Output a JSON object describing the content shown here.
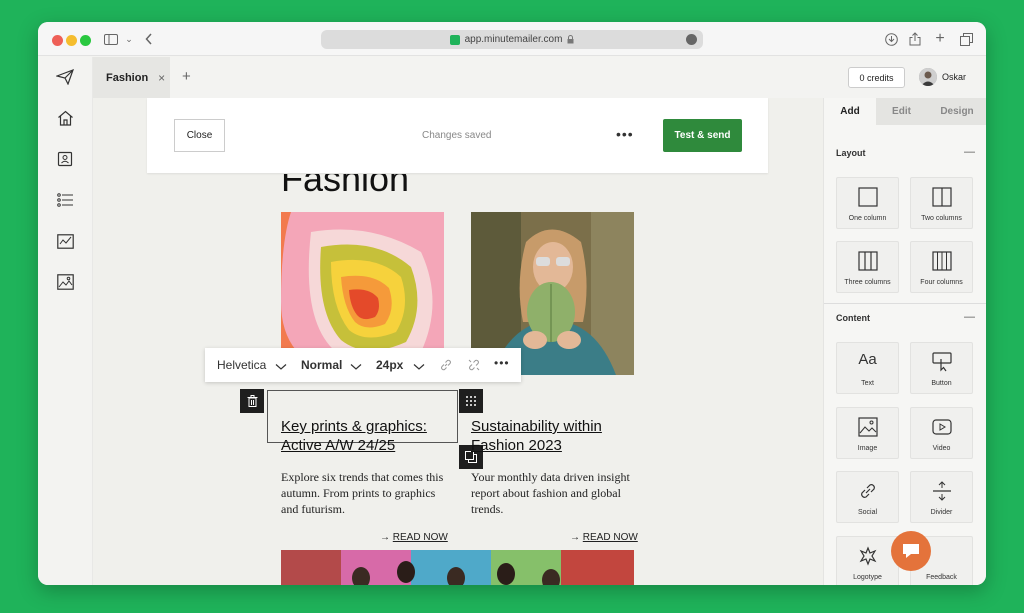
{
  "browser": {
    "url": "app.minutemailer.com"
  },
  "tabs": {
    "active": "Fashion",
    "close_glyph": "×",
    "new_glyph": "+"
  },
  "header": {
    "credits": "0 credits",
    "user": "Oskar"
  },
  "editor": {
    "close": "Close",
    "status": "Changes saved",
    "more": "•••",
    "send": "Test & send"
  },
  "email": {
    "heading": "Fashion",
    "cards": [
      {
        "title": "Key prints & graphics: Active A/W 24/25",
        "body": "Explore six trends that comes this autumn. From prints to graphics and futurism.",
        "cta_arrow": "→",
        "cta": "READ NOW"
      },
      {
        "title": "Sustainability within Fashion 2023",
        "body": "Your monthly data driven insight report about fashion and global trends.",
        "cta_arrow": "→",
        "cta": "READ NOW"
      }
    ]
  },
  "format_toolbar": {
    "font": "Helvetica",
    "style": "Normal",
    "size": "24px",
    "more": "•••"
  },
  "panel": {
    "tabs": [
      "Add",
      "Edit",
      "Design"
    ],
    "layout_title": "Layout",
    "content_title": "Content",
    "collapse_glyph": "—",
    "layout_items": [
      "One column",
      "Two columns",
      "Three columns",
      "Four columns"
    ],
    "content_items": [
      "Text",
      "Button",
      "Image",
      "Video",
      "Social",
      "Divider",
      "Logotype",
      "Feedback"
    ],
    "text_glyph": "Aa"
  },
  "colors": {
    "accent": "#2f8a3c",
    "background": "#1fb35a",
    "chat": "#e4733b"
  }
}
